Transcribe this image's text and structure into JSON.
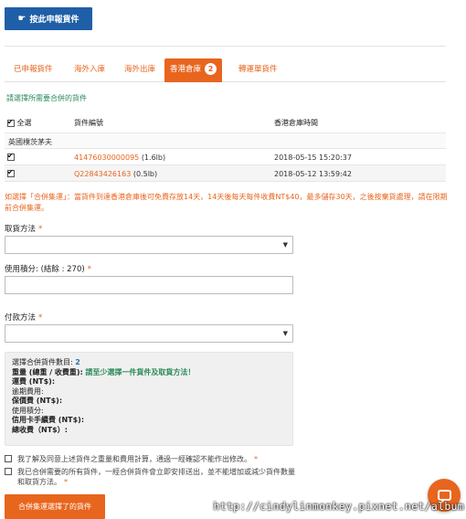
{
  "header": {
    "report_button": "按此申報貨件"
  },
  "tabs": [
    {
      "label": "已申報貨件",
      "active": false
    },
    {
      "label": "海外入庫",
      "active": false
    },
    {
      "label": "海外出庫",
      "active": false
    },
    {
      "label": "香港倉庫",
      "active": true,
      "count": "2"
    },
    {
      "label": "轉運單貨件",
      "active": false
    }
  ],
  "instruction": "請選擇所需要合併的貨件",
  "table": {
    "select_all": "全選",
    "col_package": "貨件編號",
    "col_time": "香港倉庫時間",
    "group": "英國樸茨茅夫",
    "rows": [
      {
        "checked": true,
        "number": "41476030000095",
        "weight": "(1.6lb)",
        "time": "2018-05-15 15:20:37"
      },
      {
        "checked": true,
        "number": "Q22843426163",
        "weight": "(0.5lb)",
        "time": "2018-05-12 13:59:42"
      }
    ]
  },
  "note": "如選擇「合併集運」：當貨件到達香港倉庫後可免費存放14天，14天後每天每件收費NT$40，最多儲存30天，之後按棄貨處理，請在限期前合併集運。",
  "form": {
    "pickup_label": "取貨方法",
    "points_label": "使用積分: (結餘 : 270)",
    "payment_label": "付款方法",
    "required_mark": "*",
    "dropdown_arrow": "▼"
  },
  "summary": {
    "count_label": "選擇合併貨件數目:",
    "count_value": "2",
    "weight_label": "重量 (總重 / 收費重):",
    "weight_value": "請至少選擇一件貨件及取貨方法！",
    "freight_label": "運費 (NT$):",
    "overdue_label": "逾期費用:",
    "insurance_label": "保價費 (NT$):",
    "points_label": "使用積分:",
    "card_fee_label": "信用卡手續費 (NT$):",
    "total_label": "總收費（NT$）:"
  },
  "agreements": [
    "我了解及同意上述貨件之重量和費用計算，通過一經確認不能作出修改。",
    "我已合併需要的所有貨件，一經合併貨件會立即安排送出，並不能增加或減少貨件數量和取貨方法。"
  ],
  "submit_button": "合併集運選擇了的貨件",
  "watermark": "http://cindylinmonkey.pixnet.net/album"
}
